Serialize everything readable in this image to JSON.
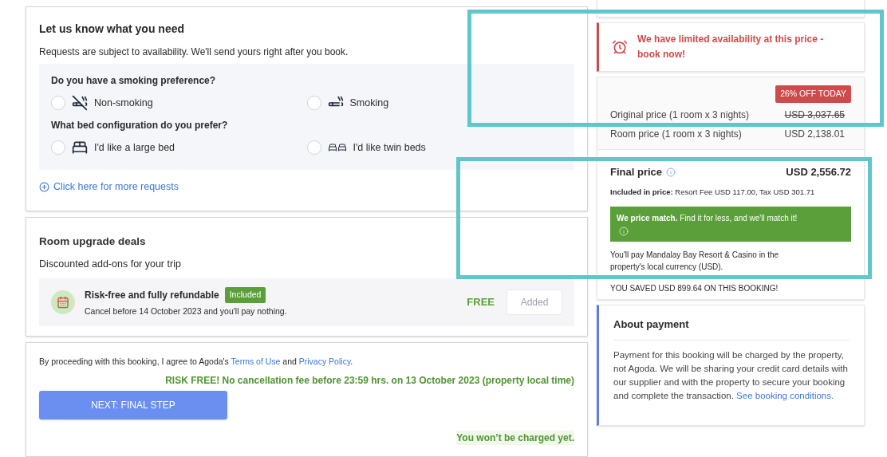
{
  "requests": {
    "title": "Let us know what you need",
    "subtitle": "Requests are subject to availability. We'll send yours right after you book.",
    "groups": [
      {
        "question": "Do you have a smoking preference?",
        "options": [
          {
            "label": "Non-smoking",
            "selected": false
          },
          {
            "label": "Smoking",
            "selected": false
          }
        ]
      },
      {
        "question": "What bed configuration do you prefer?",
        "options": [
          {
            "label": "I'd like a large bed",
            "selected": false
          },
          {
            "label": "I'd like twin beds",
            "selected": false
          }
        ]
      }
    ],
    "more_link": "Click here for more requests"
  },
  "upgrades": {
    "title": "Room upgrade deals",
    "subtitle": "Discounted add-ons for your trip",
    "items": [
      {
        "name": "Risk-free and fully refundable",
        "badge": "Included",
        "note": "Cancel before 14 October 2023 and you'll pay nothing.",
        "price": "FREE",
        "button": "Added",
        "disabled": true
      }
    ]
  },
  "checkout": {
    "agreement": [
      {
        "kind": "text",
        "text": "By proceeding with this booking, I agree to Agoda's "
      },
      {
        "kind": "link",
        "text": "Terms of Use"
      },
      {
        "kind": "text",
        "text": " and "
      },
      {
        "kind": "link",
        "text": "Privacy Policy"
      },
      {
        "kind": "text",
        "text": "."
      }
    ],
    "risk_free": "RISK FREE! No cancellation fee before 23:59 hrs. on 13 October 2023 (property local time)",
    "button": "NEXT: FINAL STEP",
    "not_charged": "You won’t be charged yet."
  },
  "alert": {
    "text": "We have limited availability at this price - book now!"
  },
  "price": {
    "discount_badge": "26% OFF TODAY",
    "rows": [
      {
        "label": "Original price (1 room x 3 nights)",
        "value": "USD 3,037.65",
        "struck": true
      },
      {
        "label": "Room price (1 room x 3 nights)",
        "value": "USD 2,138.01",
        "struck": false
      }
    ],
    "final_label": "Final price",
    "final_value": "USD 2,556.72",
    "included": "**Included in price:** Resort Fee USD 117.00, Tax USD 301.71",
    "price_match": "**We price match.** Find it for less, and we'll match it!",
    "currency_note": "You'll pay Mandalay Bay Resort & Casino in the property's local currency (USD).",
    "saved": "YOU SAVED USD 899.64 ON THIS BOOKING!"
  },
  "payment": {
    "title": "About payment",
    "body": [
      {
        "kind": "text",
        "text": "Payment for this booking will be charged by the property, not Agoda. We will be sharing your credit card details with our supplier and with the property to secure your booking and complete the transaction.  "
      },
      {
        "kind": "link",
        "text": "See booking conditions."
      }
    ]
  }
}
